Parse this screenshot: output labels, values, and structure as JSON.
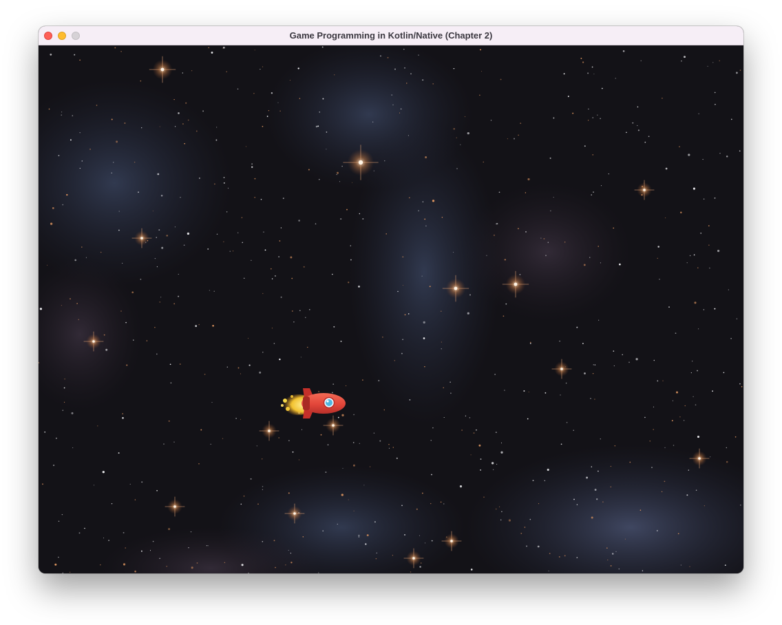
{
  "window": {
    "title": "Game Programming in Kotlin/Native (Chapter 2)"
  },
  "controls": {
    "close": {
      "icon": "close-dot-icon",
      "color": "#fe5f57"
    },
    "minimize": {
      "icon": "minimize-dot-icon",
      "color": "#febc2e"
    },
    "zoom": {
      "icon": "zoom-dot-icon",
      "color": "#d6d2d6"
    }
  },
  "scene": {
    "background": "space-starfield-nebula",
    "sprite": {
      "icon": "rocket-ship-icon",
      "hull_color": "#e2463a",
      "flame_color": "#f4d23a",
      "window_color": "#4fb6e0"
    }
  }
}
